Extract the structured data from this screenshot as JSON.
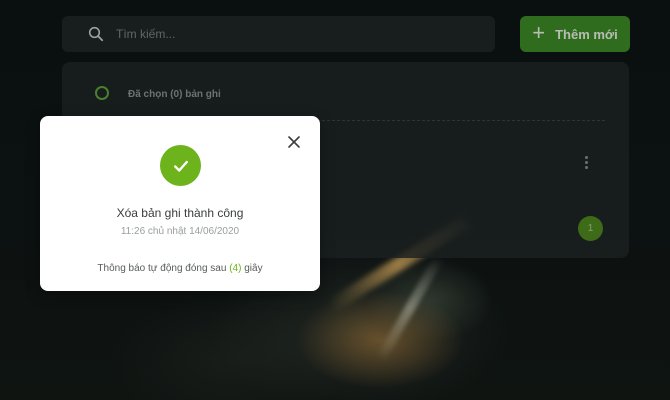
{
  "search": {
    "placeholder": "Tìm kiếm..."
  },
  "toolbar": {
    "add_label": "Thêm mới",
    "add_icon": "plus-icon"
  },
  "list": {
    "selected_label": "Đã chọn (0) bản ghi",
    "current_page": "1"
  },
  "modal": {
    "title": "Xóa bản ghi thành công",
    "timestamp": "11:26 chủ nhật 14/06/2020",
    "notice_prefix": "Thông báo tự động đóng sau",
    "countdown": "(4)",
    "notice_suffix": "giây",
    "icon": "check-circle-icon"
  },
  "colors": {
    "accent": "#6cb31c",
    "button": "#3e8b27",
    "panel": "#222929"
  }
}
